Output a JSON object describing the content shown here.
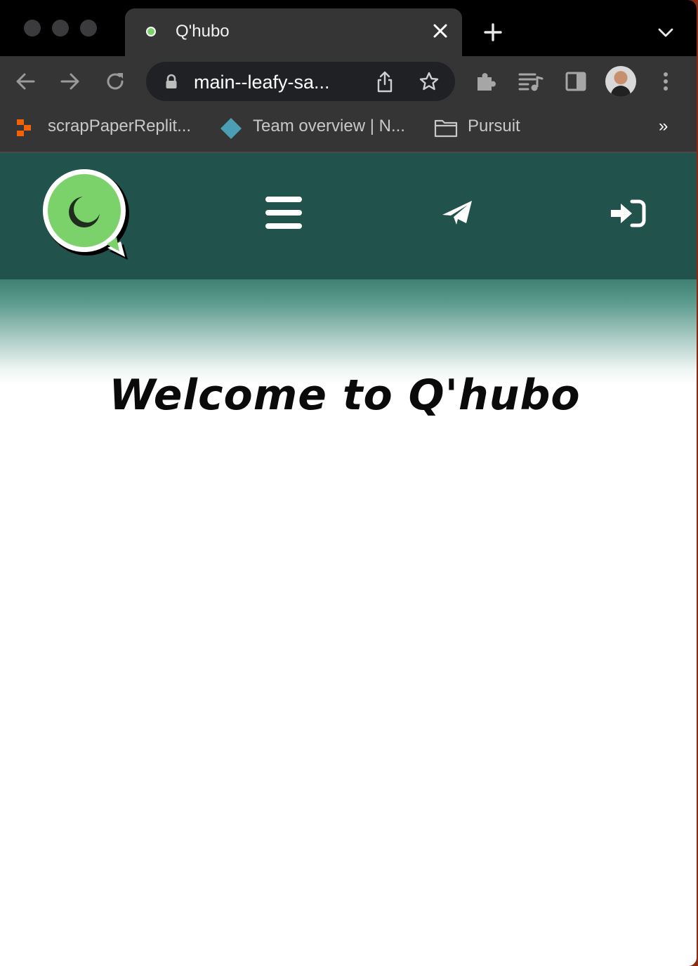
{
  "browser": {
    "tab": {
      "title": "Q'hubo",
      "favicon": "qhubo-logo-icon"
    },
    "address_bar": {
      "url": "main--leafy-sa..."
    },
    "bookmarks": [
      {
        "label": "scrapPaperReplit...",
        "icon": "replit-icon"
      },
      {
        "label": "Team overview | N...",
        "icon": "diamond-icon"
      },
      {
        "label": "Pursuit",
        "icon": "folder-icon"
      }
    ],
    "bookmarks_overflow": "»"
  },
  "app": {
    "brand": "Q'hubo",
    "colors": {
      "header_bg": "#22524c",
      "logo_green": "#7cd26a",
      "text": "#0a0a0a"
    },
    "nav": {
      "menu_icon": "hamburger-menu-icon",
      "send_icon": "paper-plane-icon",
      "signin_icon": "sign-in-icon"
    },
    "welcome_text": "Welcome to Q'hubo"
  }
}
